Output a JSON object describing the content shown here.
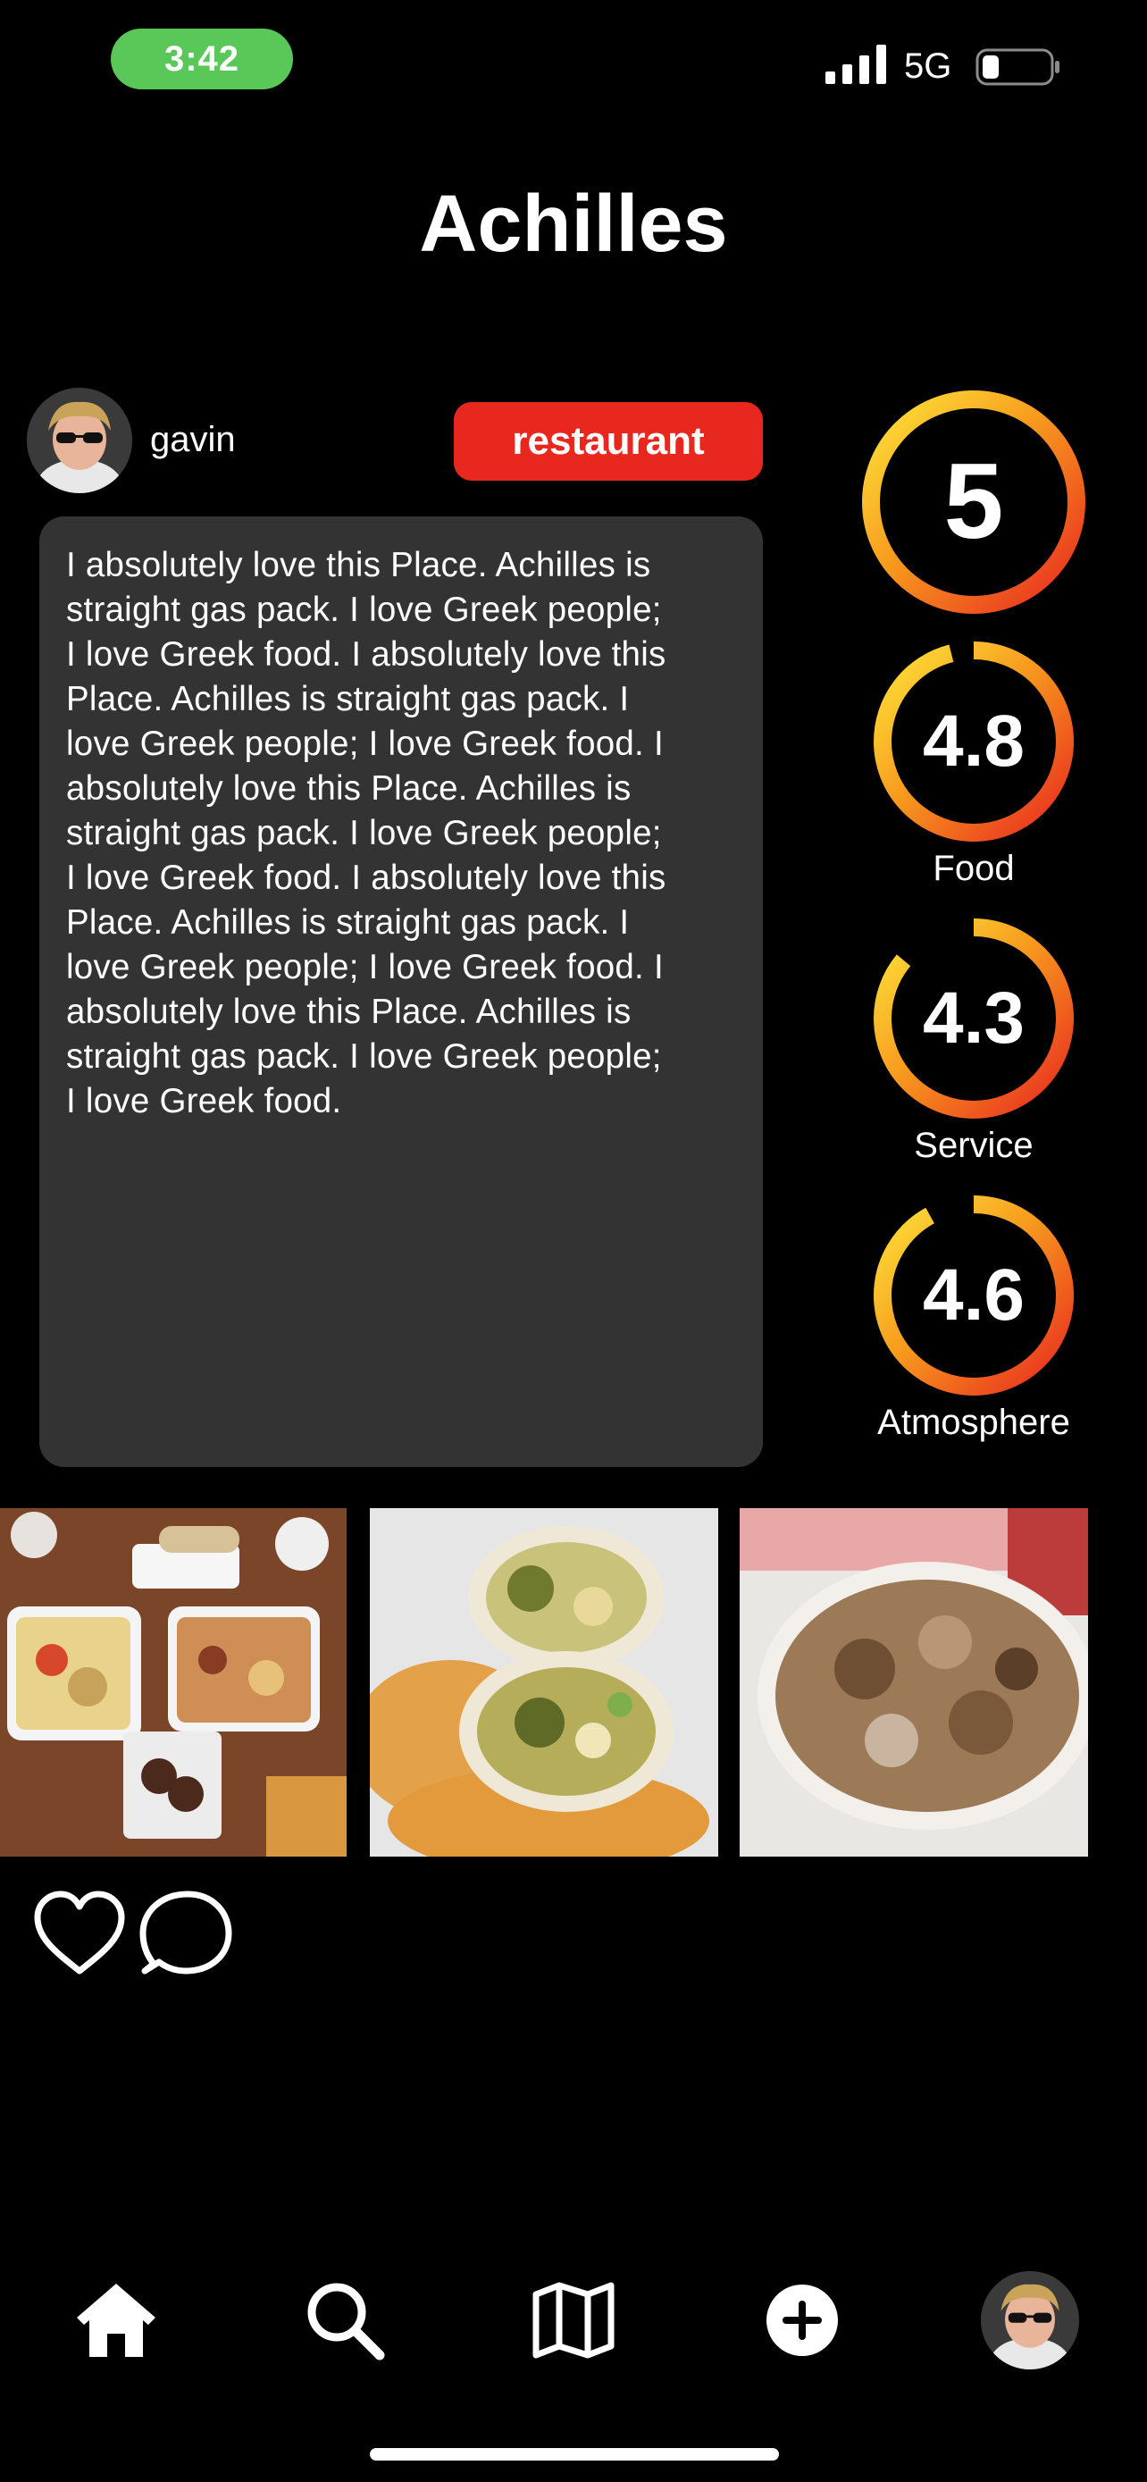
{
  "status_bar": {
    "time": "3:42",
    "network": "5G",
    "battery_level": 0.25,
    "pill_color": "#5ac759"
  },
  "post": {
    "title": "Achilles",
    "author": {
      "name": "gavin"
    },
    "tag": {
      "label": "restaurant",
      "color": "#e8281f"
    },
    "review": "I absolutely love this Place. Achilles is\nstraight gas pack. I love Greek people;\nI love Greek food. I absolutely love this\nPlace. Achilles is straight gas pack. I\nlove Greek people; I love Greek food. I\nabsolutely love this Place. Achilles is\nstraight gas pack. I love Greek people;\nI love Greek food. I absolutely love this\nPlace. Achilles is straight gas pack. I\nlove Greek people; I love Greek food. I\nabsolutely love this Place. Achilles is\nstraight gas pack. I love Greek people;\nI love Greek food.",
    "ratings": {
      "max": 5,
      "overall": {
        "value": "5",
        "score": 5
      },
      "items": [
        {
          "label": "Food",
          "value": "4.8",
          "score": 4.8
        },
        {
          "label": "Service",
          "value": "4.3",
          "score": 4.3
        },
        {
          "label": "Atmosphere",
          "value": "4.6",
          "score": 4.6
        }
      ],
      "gradient": [
        "#e8281f",
        "#f79a1e",
        "#fde53a"
      ]
    },
    "photos": [
      {
        "name": "food-platter-photo"
      },
      {
        "name": "falafel-wrap-photo"
      },
      {
        "name": "gyro-meat-photo"
      }
    ],
    "actions": [
      {
        "name": "like-button",
        "icon": "heart-icon"
      },
      {
        "name": "comment-button",
        "icon": "chat-bubble-icon"
      }
    ]
  },
  "tab_bar": {
    "items": [
      {
        "name": "tab-home",
        "icon": "home-icon"
      },
      {
        "name": "tab-search",
        "icon": "search-icon"
      },
      {
        "name": "tab-map",
        "icon": "map-icon"
      },
      {
        "name": "tab-add",
        "icon": "plus-circle-icon"
      },
      {
        "name": "tab-profile",
        "icon": "avatar"
      }
    ]
  }
}
